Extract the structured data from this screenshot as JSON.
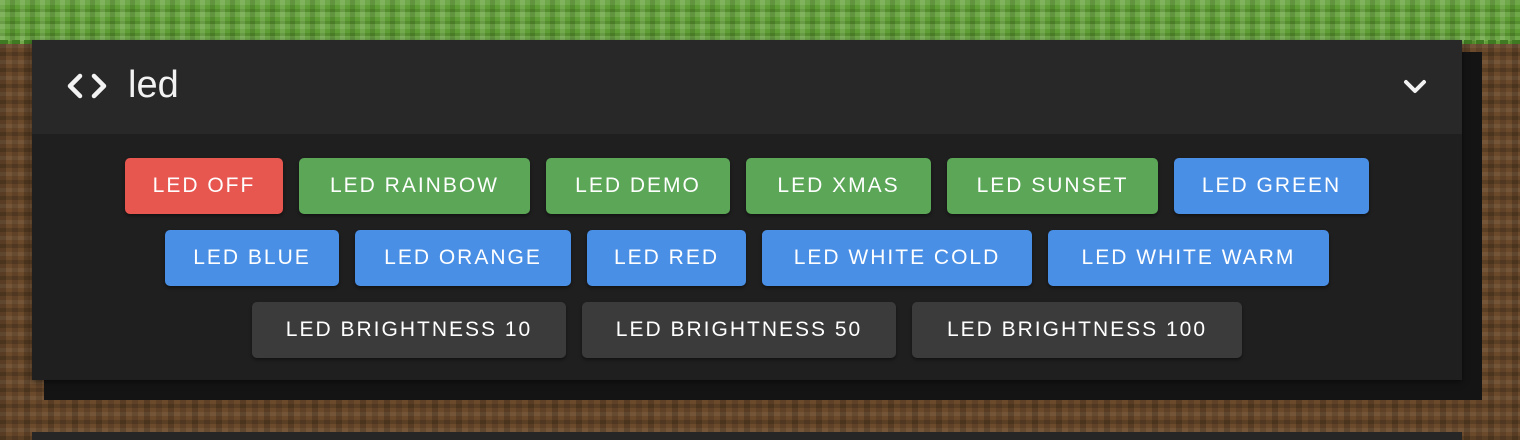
{
  "card": {
    "title": "led",
    "header_icon": "code-icon",
    "collapse_icon": "chevron-down-icon"
  },
  "buttons": {
    "led_off": "LED OFF",
    "led_rainbow": "LED RAINBOW",
    "led_demo": "LED DEMO",
    "led_xmas": "LED XMAS",
    "led_sunset": "LED SUNSET",
    "led_green": "LED GREEN",
    "led_blue": "LED BLUE",
    "led_orange": "LED ORANGE",
    "led_red": "LED RED",
    "led_white_cold": "LED WHITE COLD",
    "led_white_warm": "LED WHITE WARM",
    "led_brightness_10": "LED BRIGHTNESS 10",
    "led_brightness_50": "LED BRIGHTNESS 50",
    "led_brightness_100": "LED BRIGHTNESS 100"
  },
  "colors": {
    "off": "#e85650",
    "effect": "#5ba657",
    "color": "#4a8fe6",
    "brightness": "#3b3b3b"
  }
}
